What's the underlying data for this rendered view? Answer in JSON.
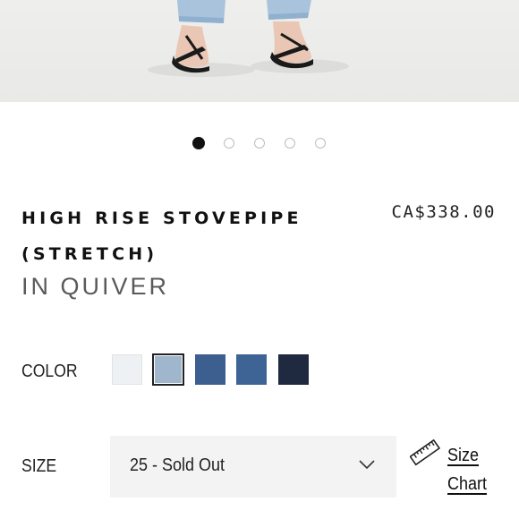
{
  "product": {
    "title": "HIGH RISE STOVEPIPE (STRETCH)",
    "price": "CA$338.00",
    "shade": "IN QUIVER"
  },
  "gallery": {
    "slide_count": 5,
    "active_slide": 1
  },
  "color": {
    "label": "COLOR",
    "swatches": [
      {
        "hex": "#eef1f4",
        "selected": false
      },
      {
        "hex": "#9fb6cc",
        "selected": true
      },
      {
        "hex": "#3d5f8f",
        "selected": false
      },
      {
        "hex": "#3e6496",
        "selected": false
      },
      {
        "hex": "#1f2a40",
        "selected": false
      }
    ]
  },
  "size": {
    "label": "SIZE",
    "selected_value": "25 - Sold Out",
    "chart_link": "Size Chart"
  },
  "icons": {
    "size_chart": "ruler-icon",
    "dropdown": "chevron-down-icon"
  }
}
